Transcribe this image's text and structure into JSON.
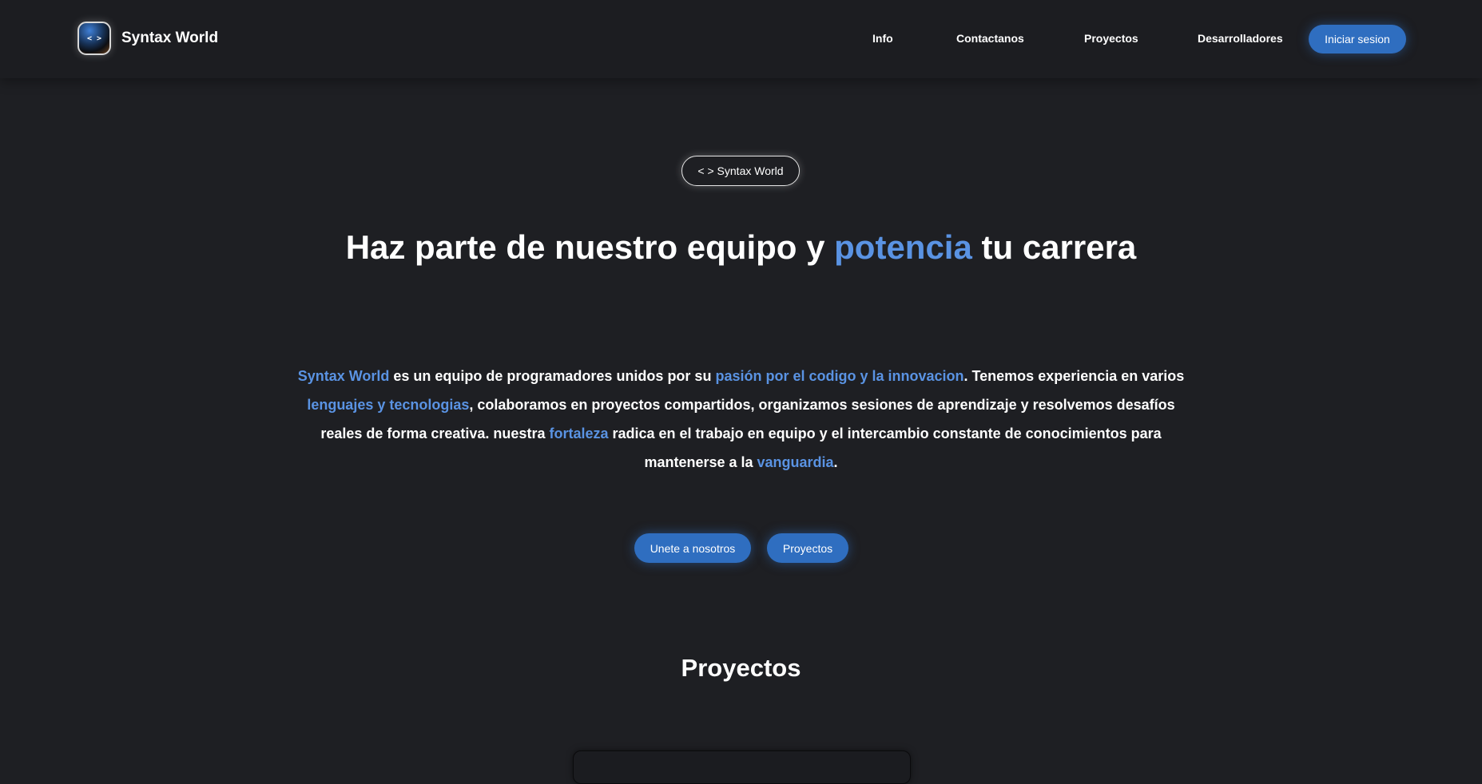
{
  "header": {
    "logo_glyph": "< >",
    "brand": "Syntax World",
    "nav": [
      "Info",
      "Contactanos",
      "Proyectos",
      "Desarrolladores"
    ],
    "login_label": "Iniciar sesion"
  },
  "hero": {
    "badge": "< > Syntax World",
    "title_pre": "Haz parte de nuestro equipo y ",
    "title_accent": "potencia",
    "title_post": " tu carrera",
    "description": [
      {
        "text": "Syntax World",
        "accent": true
      },
      {
        "text": " es un equipo de programadores unidos por su ",
        "accent": false
      },
      {
        "text": "pasión por el codigo y la innovacion",
        "accent": true
      },
      {
        "text": ". Tenemos experiencia en varios ",
        "accent": false
      },
      {
        "text": "lenguajes y tecnologias",
        "accent": true
      },
      {
        "text": ", colaboramos en proyectos compartidos, organizamos sesiones de aprendizaje y resolvemos desafíos reales de forma creativa. nuestra ",
        "accent": false
      },
      {
        "text": "fortaleza",
        "accent": true
      },
      {
        "text": " radica en el trabajo en equipo y el intercambio constante de conocimientos para mantenerse a la ",
        "accent": false
      },
      {
        "text": "vanguardia",
        "accent": true
      },
      {
        "text": ".",
        "accent": false
      }
    ],
    "cta_primary": "Unete a nosotros",
    "cta_secondary": "Proyectos"
  },
  "projects": {
    "heading": "Proyectos"
  },
  "colors": {
    "background": "#1e1f23",
    "accent": "#5a93e3",
    "button": "#2f6ec0"
  }
}
